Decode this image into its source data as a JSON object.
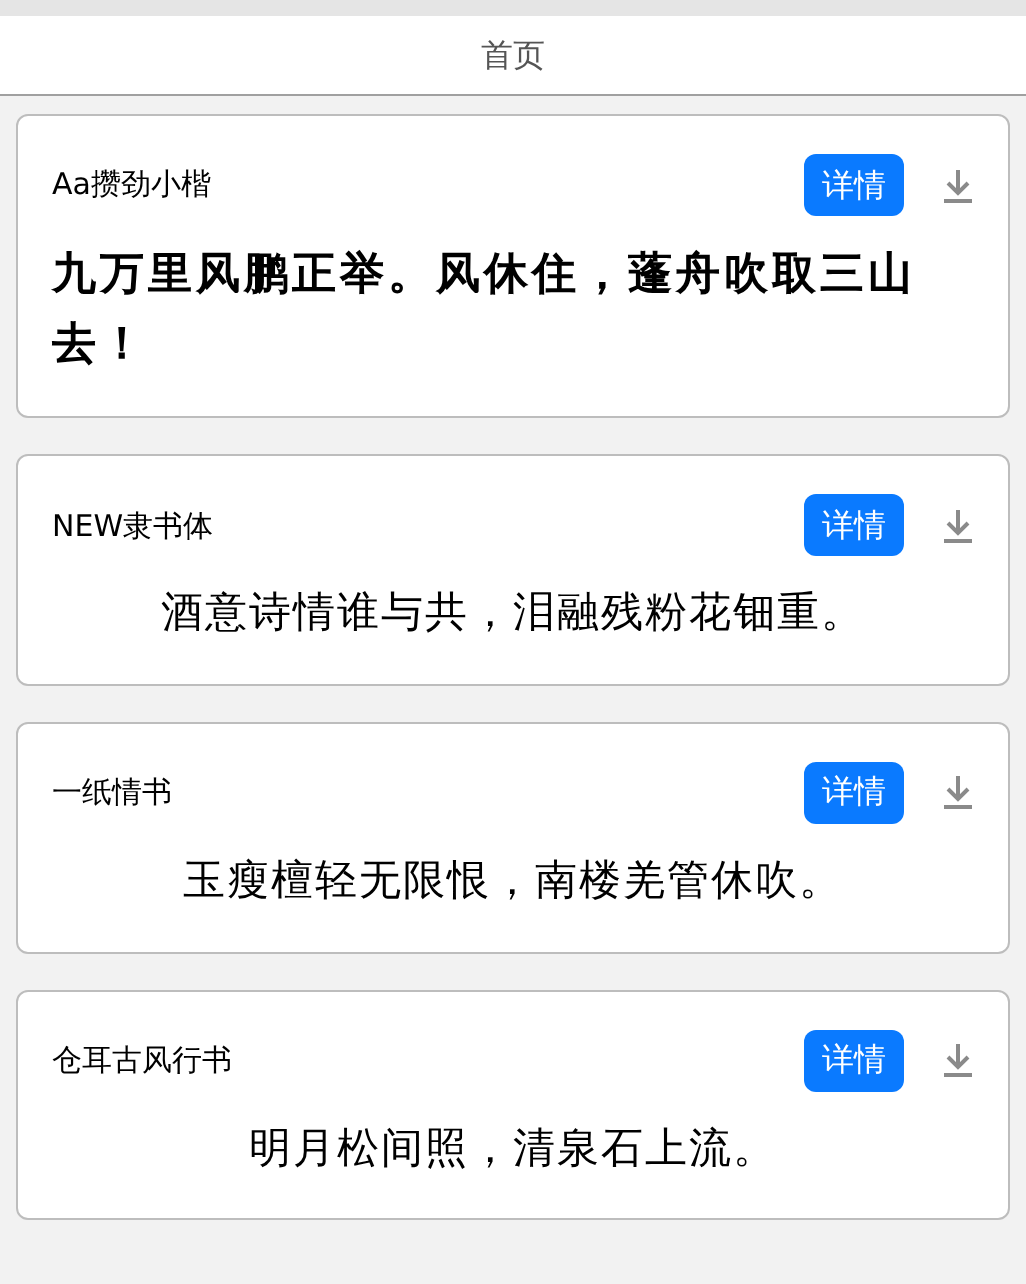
{
  "header": {
    "title": "首页"
  },
  "fonts": [
    {
      "name": "Aa攒劲小楷",
      "sample": "九万里风鹏正举。风休住，蓬舟吹取三山去！",
      "kind": "brush",
      "button": "详情"
    },
    {
      "name": "NEW隶书体",
      "sample": "酒意诗情谁与共，泪融残粉花钿重。",
      "kind": "script",
      "button": "详情"
    },
    {
      "name": "一纸情书",
      "sample": "玉瘦檀轻无限恨，南楼羌管休吹。",
      "kind": "script",
      "button": "详情"
    },
    {
      "name": "仓耳古风行书",
      "sample": "明月松间照，清泉石上流。",
      "kind": "script",
      "button": "详情"
    }
  ]
}
